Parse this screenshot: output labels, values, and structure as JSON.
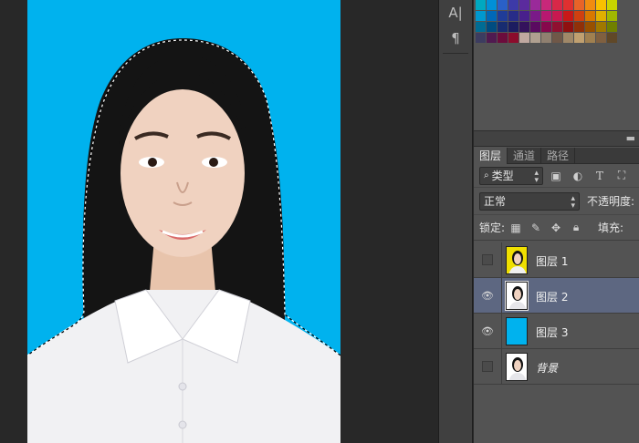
{
  "toolbar": {
    "type_tool_label": "A|",
    "paragraph_label": "¶"
  },
  "swatches": {
    "rows": [
      [
        "#00a8c0",
        "#0090d8",
        "#2a60c8",
        "#3d3aa8",
        "#5b2b9e",
        "#9a2a9a",
        "#c8287a",
        "#d82848",
        "#e03030",
        "#e86428",
        "#f08c10",
        "#f8c000",
        "#c8d400"
      ],
      [
        "#0098d0",
        "#0068b8",
        "#203c98",
        "#282c88",
        "#48208c",
        "#7a1a88",
        "#b81870",
        "#c81850",
        "#c81818",
        "#d04010",
        "#d87800",
        "#e0b000",
        "#a0b800"
      ],
      [
        "#006c94",
        "#004c80",
        "#182c70",
        "#1c1c60",
        "#34125c",
        "#5a0a60",
        "#86084c",
        "#901030",
        "#901010",
        "#903008",
        "#985000",
        "#a07800",
        "#708000"
      ],
      [
        "#3c3c60",
        "#501a50",
        "#6c0c3c",
        "#8c0c2c",
        "#c0a8a0",
        "#b0a090",
        "#908070",
        "#705848",
        "#a08868",
        "#c0a070",
        "#a08050",
        "#806040",
        "#604828"
      ]
    ]
  },
  "layers_panel": {
    "tabs": [
      "图层",
      "通道",
      "路径"
    ],
    "filter": {
      "label": "类型"
    },
    "blend_mode": "正常",
    "opacity_label": "不透明度:",
    "lock_label": "锁定:",
    "fill_label": "填充:",
    "layers": [
      {
        "name": "图层 1",
        "visible": false,
        "selected": false,
        "thumb": "photo-yellow"
      },
      {
        "name": "图层 2",
        "visible": true,
        "selected": true,
        "thumb": "photo-white"
      },
      {
        "name": "图层 3",
        "visible": true,
        "selected": false,
        "thumb": "solid-blue"
      },
      {
        "name": "背景",
        "visible": false,
        "selected": false,
        "thumb": "photo-white",
        "italic": true
      }
    ]
  },
  "colors": {
    "canvas_bg": "#00b2ee",
    "panel_bg": "#535353",
    "selected_layer": "#5d6781"
  }
}
